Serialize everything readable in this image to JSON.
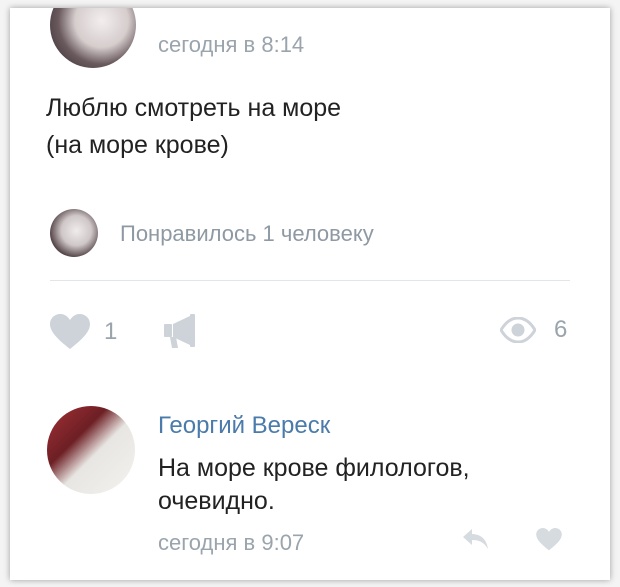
{
  "post": {
    "timestamp": "сегодня в 8:14",
    "text_lines": [
      "Люблю смотреть на море",
      "(на море крове)"
    ],
    "likes_summary": "Понравилось 1 человеку"
  },
  "actions": {
    "like_count": "1",
    "views_count": "6"
  },
  "comment": {
    "author": "Георгий Вереск",
    "text_lines": [
      "На море крове филологов,",
      "очевидно."
    ],
    "timestamp": "сегодня в 9:07"
  },
  "icons": {
    "like": "heart-icon",
    "repost": "megaphone-icon",
    "views": "eye-icon",
    "reply": "reply-arrow-icon",
    "comment_like": "heart-icon"
  },
  "colors": {
    "author_link": "#4a7bab",
    "muted_text": "#9aa4ad",
    "icon": "#cdd3d9"
  }
}
